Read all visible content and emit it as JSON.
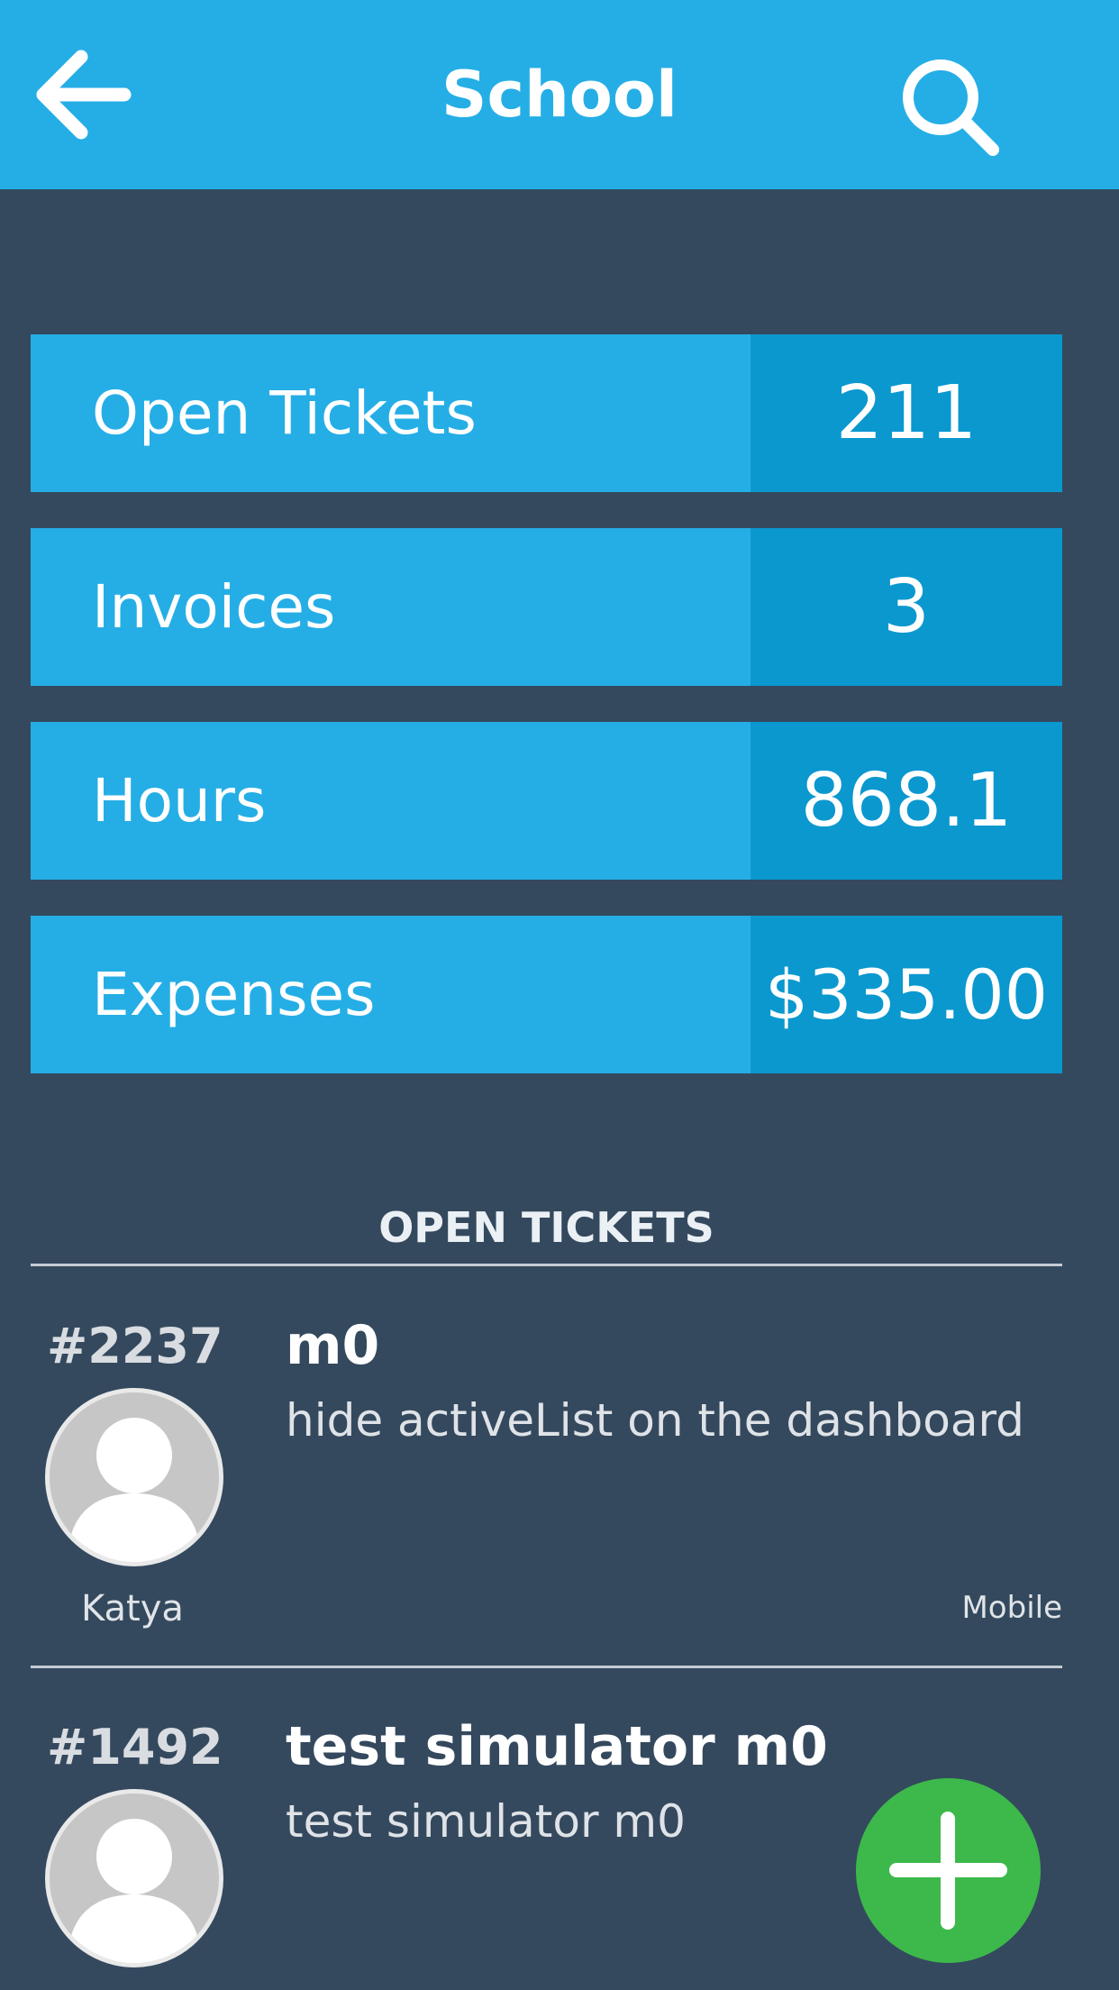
{
  "header": {
    "title": "School",
    "back_icon": "arrow-left-icon",
    "search_icon": "search-icon",
    "background": "#25aee6"
  },
  "stats": [
    {
      "label": "Open Tickets",
      "value": "211"
    },
    {
      "label": "Invoices",
      "value": "3"
    },
    {
      "label": "Hours",
      "value": "868.1"
    },
    {
      "label": "Expenses",
      "value": "$335.00"
    }
  ],
  "section": {
    "title": "OPEN TICKETS"
  },
  "tickets": [
    {
      "id": "#2237",
      "title": "m0",
      "description": "hide activeList on the dashboard",
      "user": "Katya",
      "source": "Mobile"
    },
    {
      "id": "#1492",
      "title": "test simulator m0",
      "description": "test simulator m0"
    }
  ],
  "fab": {
    "icon": "plus-icon",
    "color": "#3cb94a"
  },
  "colors": {
    "page_background": "#34495e",
    "stat_label_bg": "#25aee6",
    "stat_value_bg": "#0a98cf"
  }
}
